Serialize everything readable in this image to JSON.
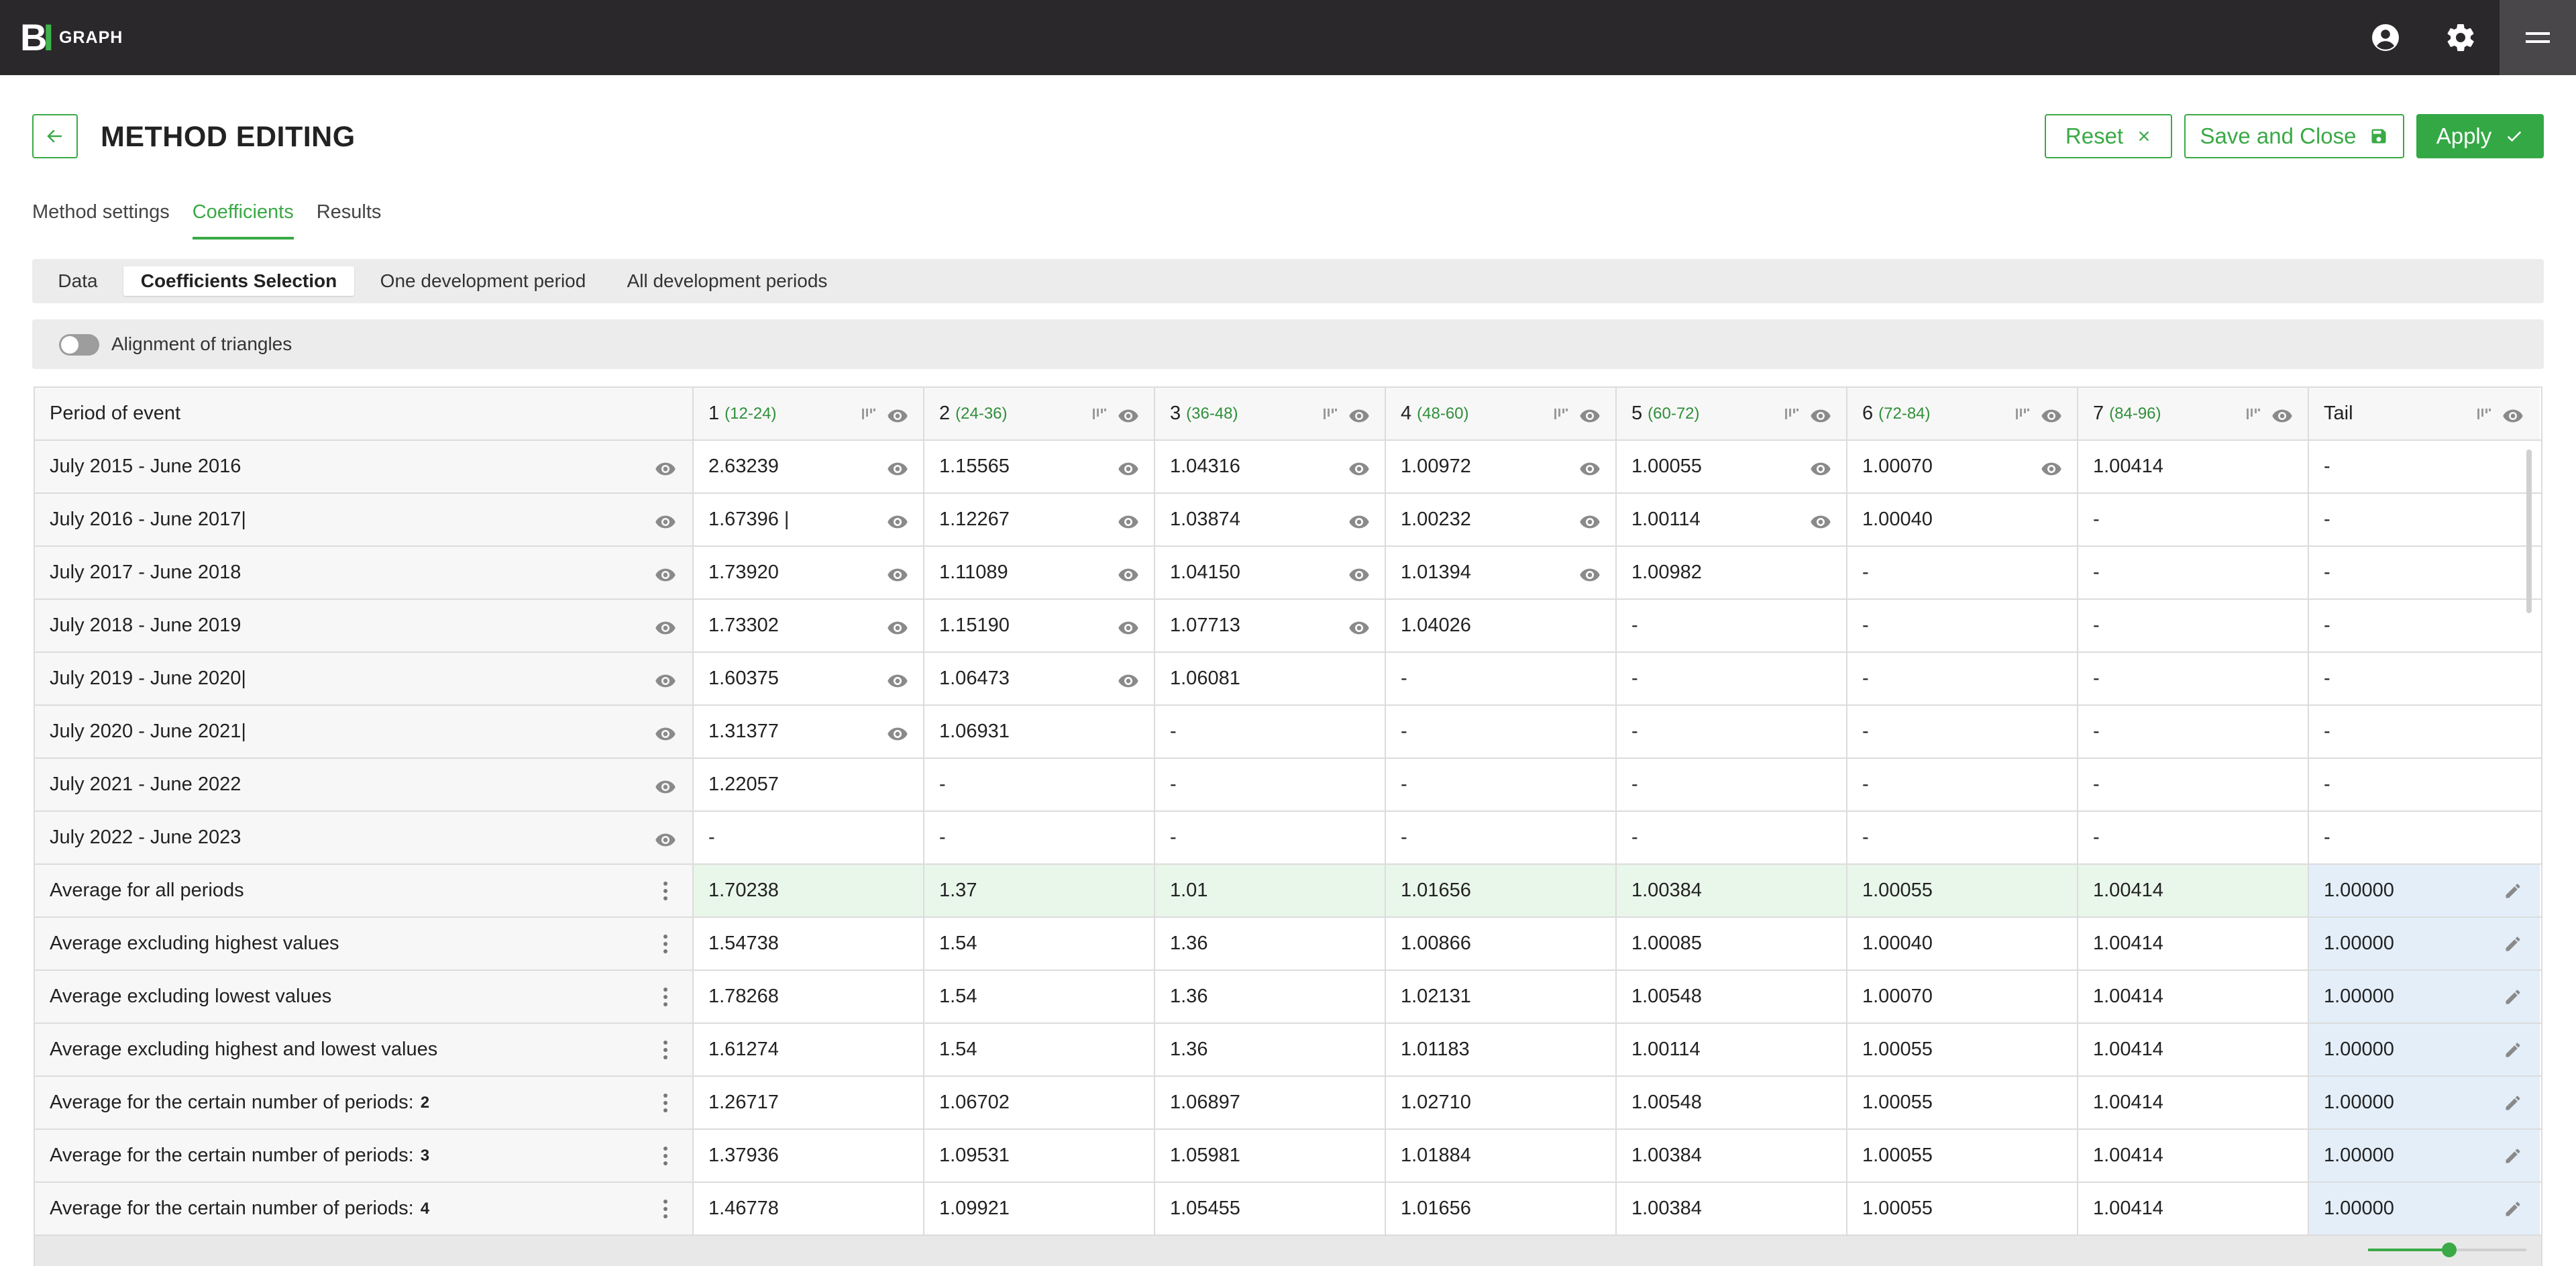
{
  "app": {
    "logo_mark": "BI",
    "logo_text": "GRAPH"
  },
  "topbar": {
    "icons": [
      "account-icon",
      "settings-icon",
      "menu-icon"
    ]
  },
  "page": {
    "title": "METHOD EDITING"
  },
  "actions": {
    "reset": "Reset",
    "save_close": "Save and Close",
    "apply": "Apply"
  },
  "tabs": [
    "Method settings",
    "Coefficients",
    "Results"
  ],
  "active_tab": "Coefficients",
  "subtabs": [
    "Data",
    "Coefficients Selection",
    "One development period",
    "All development periods"
  ],
  "active_subtab": "Coefficients Selection",
  "alignment": {
    "label": "Alignment of triangles",
    "enabled": false
  },
  "table": {
    "first_header": "Period of event",
    "columns": [
      {
        "label": "1",
        "range": "(12-24)"
      },
      {
        "label": "2",
        "range": "(24-36)"
      },
      {
        "label": "3",
        "range": "(36-48)"
      },
      {
        "label": "4",
        "range": "(48-60)"
      },
      {
        "label": "5",
        "range": "(60-72)"
      },
      {
        "label": "6",
        "range": "(72-84)"
      },
      {
        "label": "7",
        "range": "(84-96)"
      },
      {
        "label": "Tail",
        "range": ""
      }
    ],
    "rows": [
      {
        "label": "July 2015 - June 2016",
        "values": [
          "2.63239",
          "1.15565",
          "1.04316",
          "1.00972",
          "1.00055",
          "1.00070",
          "1.00414",
          "-"
        ]
      },
      {
        "label": "July 2016 - June 2017|",
        "values": [
          "1.67396 |",
          "1.12267",
          "1.03874",
          "1.00232",
          "1.00114",
          "1.00040",
          "-",
          "-"
        ]
      },
      {
        "label": "July 2017 - June 2018",
        "values": [
          "1.73920",
          "1.11089",
          "1.04150",
          "1.01394",
          "1.00982",
          "-",
          "-",
          "-"
        ]
      },
      {
        "label": "July 2018 - June 2019",
        "values": [
          "1.73302",
          "1.15190",
          "1.07713",
          "1.04026",
          "-",
          "-",
          "-",
          "-"
        ]
      },
      {
        "label": "July 2019 - June 2020|",
        "values": [
          "1.60375",
          "1.06473",
          "1.06081",
          "-",
          "-",
          "-",
          "-",
          "-"
        ]
      },
      {
        "label": "July 2020 - June 2021|",
        "values": [
          "1.31377",
          "1.06931",
          "-",
          "-",
          "-",
          "-",
          "-",
          "-"
        ]
      },
      {
        "label": "July 2021 - June 2022",
        "values": [
          "1.22057",
          "-",
          "-",
          "-",
          "-",
          "-",
          "-",
          "-"
        ]
      },
      {
        "label": "July 2022 - June 2023",
        "values": [
          "-",
          "-",
          "-",
          "-",
          "-",
          "-",
          "-",
          "-"
        ]
      }
    ],
    "averages": [
      {
        "label": "Average for all periods",
        "count": "",
        "values": [
          "1.70238",
          "1.37",
          "1.01",
          "1.01656",
          "1.00384",
          "1.00055",
          "1.00414",
          "1.00000"
        ],
        "selected": true
      },
      {
        "label": "Average excluding highest values",
        "count": "",
        "values": [
          "1.54738",
          "1.54",
          "1.36",
          "1.00866",
          "1.00085",
          "1.00040",
          "1.00414",
          "1.00000"
        ]
      },
      {
        "label": "Average excluding lowest values",
        "count": "",
        "values": [
          "1.78268",
          "1.54",
          "1.36",
          "1.02131",
          "1.00548",
          "1.00070",
          "1.00414",
          "1.00000"
        ]
      },
      {
        "label": "Average excluding highest and lowest values",
        "count": "",
        "values": [
          "1.61274",
          "1.54",
          "1.36",
          "1.01183",
          "1.00114",
          "1.00055",
          "1.00414",
          "1.00000"
        ]
      },
      {
        "label": "Average for the certain number of periods:",
        "count": "2",
        "values": [
          "1.26717",
          "1.06702",
          "1.06897",
          "1.02710",
          "1.00548",
          "1.00055",
          "1.00414",
          "1.00000"
        ]
      },
      {
        "label": "Average for the certain number of periods:",
        "count": "3",
        "values": [
          "1.37936",
          "1.09531",
          "1.05981",
          "1.01884",
          "1.00384",
          "1.00055",
          "1.00414",
          "1.00000"
        ]
      },
      {
        "label": "Average for the certain number of periods:",
        "count": "4",
        "values": [
          "1.46778",
          "1.09921",
          "1.05455",
          "1.01656",
          "1.00384",
          "1.00055",
          "1.00414",
          "1.00000"
        ]
      }
    ]
  },
  "zoom_slider": {
    "value": 0.5
  },
  "colors": {
    "accent": "#3aa946",
    "topbar": "#2b282b",
    "selected_row": "#e9f6ea",
    "tail_column": "#e3eef9"
  }
}
